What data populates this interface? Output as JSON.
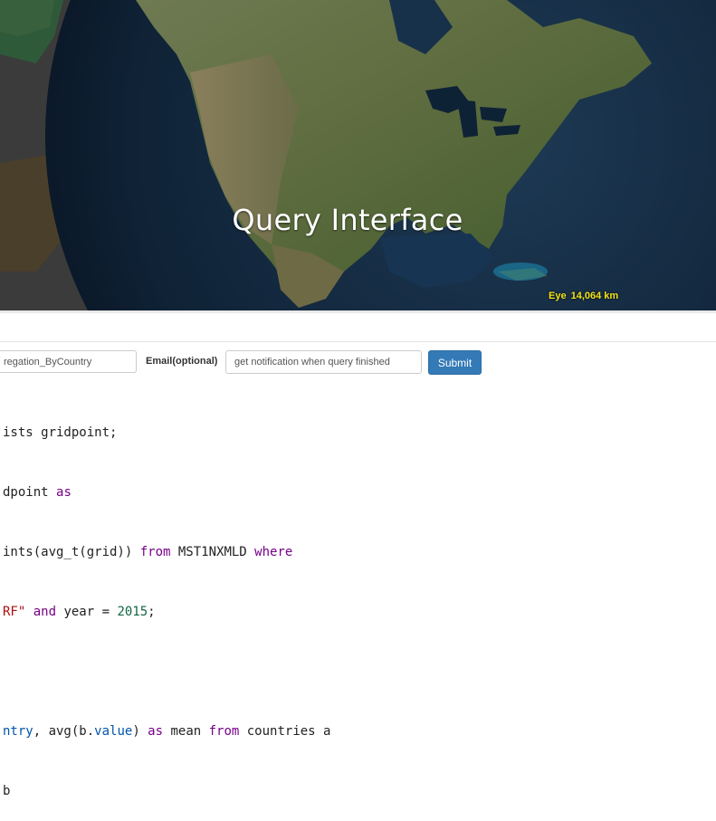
{
  "hero": {
    "title": "Query Interface",
    "eye_label": "Eye",
    "eye_value": "14,064 km"
  },
  "form": {
    "name_value": "regation_ByCountry",
    "email_label": "Email(optional)",
    "email_placeholder": "get notification when query finished",
    "submit_label": "Submit"
  },
  "code": {
    "line1_a": "ists gridpoint;",
    "line2_a": "dpoint ",
    "line2_kw": "as",
    "line3_a": "ints(avg_t(grid)) ",
    "line3_kw1": "from",
    "line3_b": " MST1NXMLD ",
    "line3_kw2": "where",
    "line4_str": "RF\"",
    "line4_kw": " and",
    "line4_b": " year = ",
    "line4_num": "2015",
    "line4_c": ";",
    "line6_prop": "ntry",
    "line6_a": ", avg(b.",
    "line6_prop2": "value",
    "line6_b": ") ",
    "line6_kw1": "as",
    "line6_c": " mean ",
    "line6_kw2": "from",
    "line6_d": " countries a",
    "line7_a": "b"
  },
  "colors": {
    "submit_bg": "#337ab7",
    "eye_label": "#f2e419",
    "keyword": "#770088",
    "string": "#aa1111",
    "number": "#116644",
    "property": "#0055aa"
  }
}
